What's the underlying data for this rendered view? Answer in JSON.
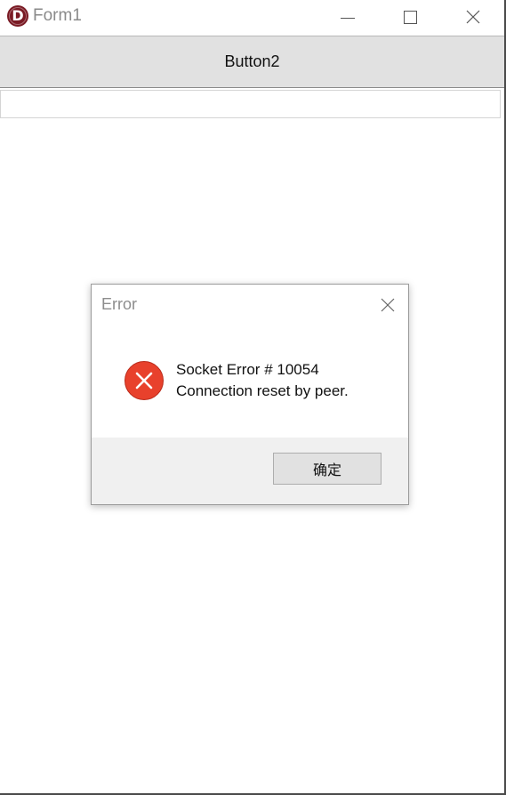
{
  "window": {
    "title": "Form1"
  },
  "main": {
    "button2_label": "Button2",
    "edit_value": ""
  },
  "dialog": {
    "title": "Error",
    "message_line1": "Socket Error # 10054",
    "message_line2": "Connection reset by peer.",
    "ok_label": "确定",
    "icon": "error-icon"
  },
  "icons": {
    "app": "delphi-app-icon",
    "minimize": "minimize-icon",
    "maximize": "maximize-icon",
    "close": "close-icon"
  },
  "colors": {
    "error_red": "#e8412c",
    "app_icon": "#7a1a24"
  }
}
